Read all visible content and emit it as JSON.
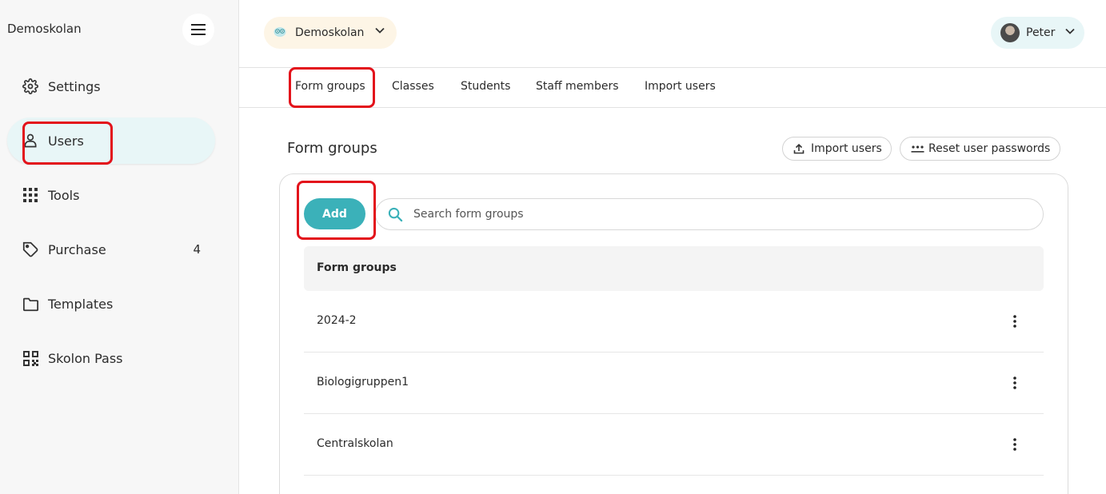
{
  "sidebar": {
    "brand": "Demoskolan",
    "items": [
      {
        "label": "Settings",
        "icon": "gear-icon"
      },
      {
        "label": "Users",
        "icon": "user-icon",
        "active": true
      },
      {
        "label": "Tools",
        "icon": "grid-icon"
      },
      {
        "label": "Purchase",
        "icon": "tag-icon",
        "count": "4"
      },
      {
        "label": "Templates",
        "icon": "folder-icon"
      },
      {
        "label": "Skolon Pass",
        "icon": "qr-code-icon"
      }
    ]
  },
  "header": {
    "school_selector": "Demoskolan",
    "user_name": "Peter"
  },
  "tabs": [
    {
      "label": "Form groups",
      "active": true
    },
    {
      "label": "Classes"
    },
    {
      "label": "Students"
    },
    {
      "label": "Staff members"
    },
    {
      "label": "Import users"
    }
  ],
  "main": {
    "title": "Form groups",
    "import_users_label": "Import users",
    "reset_passwords_label": "Reset user passwords",
    "add_label": "Add",
    "search_placeholder": "Search form groups",
    "table": {
      "column_header": "Form groups",
      "rows": [
        "2024-2",
        "Biologigruppen1",
        "Centralskolan"
      ]
    }
  },
  "colors": {
    "accent": "#3bb1b9",
    "active_nav_bg": "#e8f6f7",
    "school_pill_bg": "#fdf5e6",
    "annotation": "#e3121b"
  }
}
